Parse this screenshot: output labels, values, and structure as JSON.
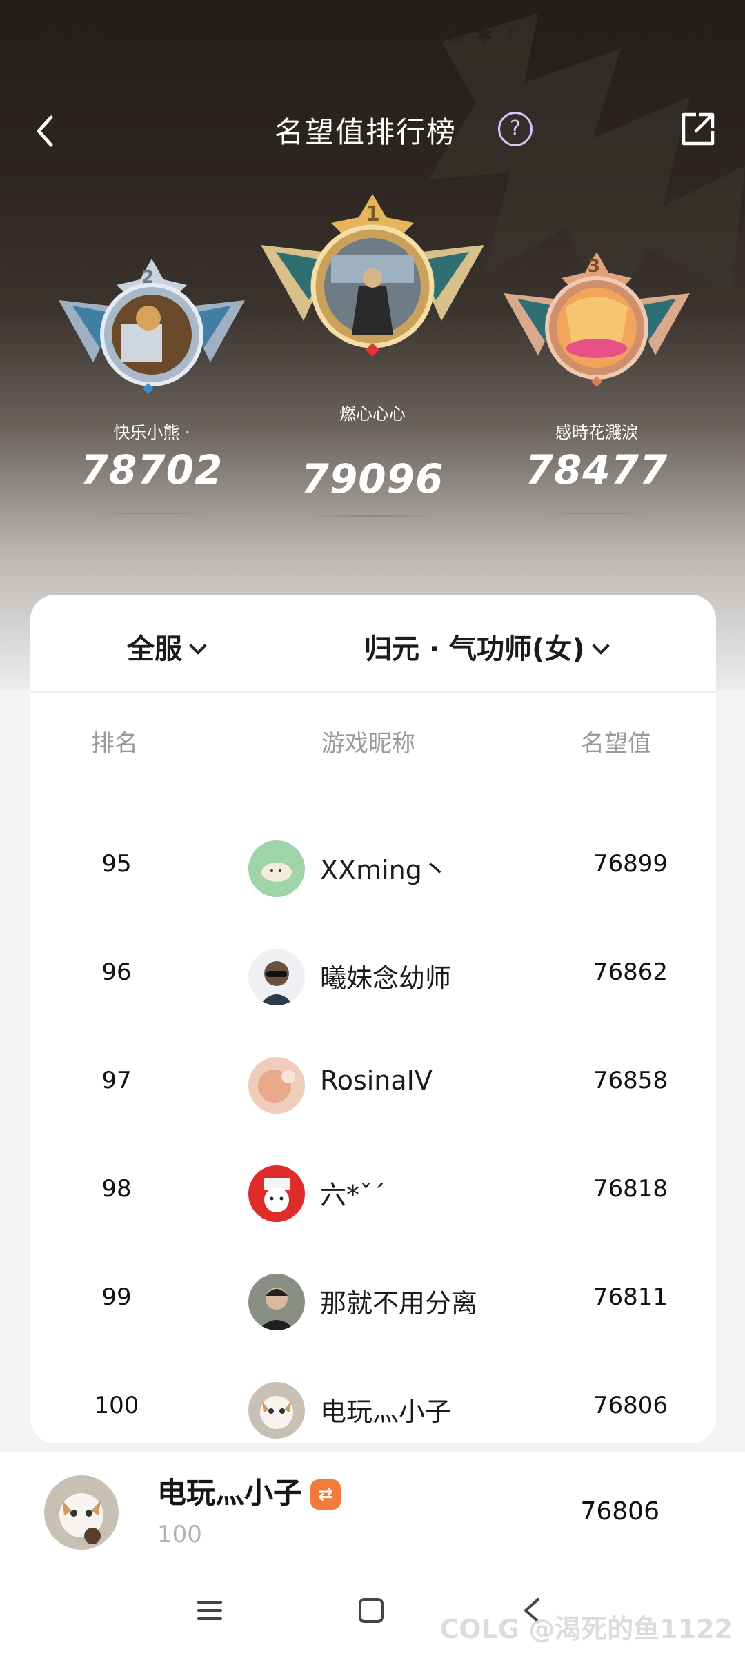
{
  "status": {
    "time": "4:32",
    "icons": "⁂ ✱ ☾ HD ⁵ᴳ ıll ıll 27"
  },
  "header": {
    "title": "名望值排行榜",
    "help_glyph": "?"
  },
  "podium": [
    {
      "rank": "2",
      "name": "快乐小熊 ·",
      "score": "78702"
    },
    {
      "rank": "1",
      "name": "燃心心心",
      "score": "79096"
    },
    {
      "rank": "3",
      "name": "感時花濺淚",
      "score": "78477"
    }
  ],
  "filters": {
    "server": "全服",
    "class": "归元 · 气功师(女)"
  },
  "columns": {
    "rank": "排名",
    "nickname": "游戏昵称",
    "fame": "名望值"
  },
  "rows": [
    {
      "rank": "95",
      "name": "XXming丶",
      "score": "76899"
    },
    {
      "rank": "96",
      "name": "曦妹念幼师",
      "score": "76862"
    },
    {
      "rank": "97",
      "name": "RosinaIV",
      "score": "76858"
    },
    {
      "rank": "98",
      "name": "六*ˇˊ",
      "score": "76818"
    },
    {
      "rank": "99",
      "name": "那就不用分离",
      "score": "76811"
    },
    {
      "rank": "100",
      "name": "电玩灬小子",
      "score": "76806"
    }
  ],
  "me": {
    "name": "电玩灬小子",
    "badge": "⇄",
    "rank": "100",
    "score": "76806"
  },
  "watermark": {
    "brand": "COLG",
    "text": "@渴死的鱼1122"
  },
  "colors": {
    "gold": "#e6b45a",
    "silver": "#b9c7d6",
    "bronze": "#e0a17d",
    "badge": "#f07b3a"
  }
}
